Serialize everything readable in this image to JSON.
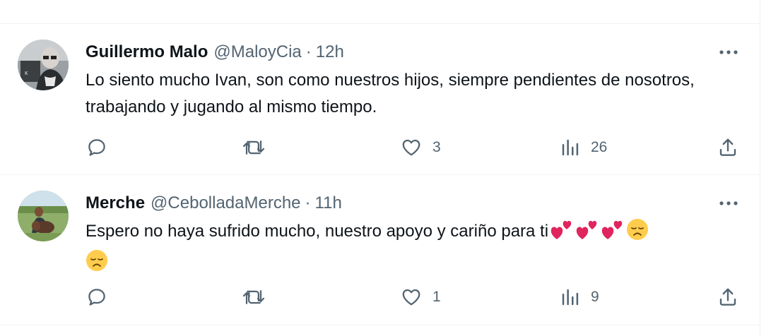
{
  "tweets": [
    {
      "name": "Guillermo Malo",
      "handle": "@MaloyCia",
      "separator": "·",
      "time": "12h",
      "text": "Lo siento mucho Ivan, son como nuestros hijos, siempre pendientes de nosotros, trabajando y jugando al mismo tiempo.",
      "reply_count": "",
      "retweet_count": "",
      "like_count": "3",
      "view_count": "26",
      "avatar_icon": "avatar-photo-man-glasses"
    },
    {
      "name": "Merche",
      "handle": "@CebolladaMerche",
      "separator": "·",
      "time": "11h",
      "text": "Espero no haya sufrido mucho, nuestro apoyo y cariño para ti",
      "emojis": [
        "two-hearts",
        "two-hearts",
        "two-hearts",
        "disappointed-face",
        "disappointed-face"
      ],
      "reply_count": "",
      "retweet_count": "",
      "like_count": "1",
      "view_count": "9",
      "avatar_icon": "avatar-photo-person-with-dog"
    }
  ],
  "colors": {
    "text": "#0f1419",
    "secondary": "#536471",
    "divider": "#eff3f4",
    "heart": "#e0245e",
    "emoji_face": "#ffcc4d"
  }
}
